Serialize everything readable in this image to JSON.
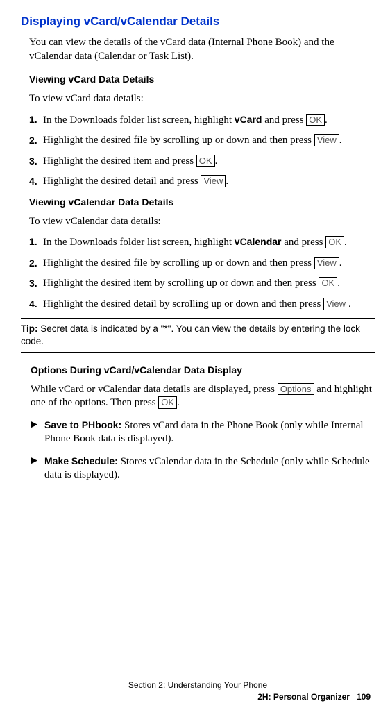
{
  "keys": {
    "ok": "OK",
    "view": "View",
    "options": "Options"
  },
  "bold": {
    "vcard": "vCard",
    "vcalendar": "vCalendar",
    "tip_label": "Tip:",
    "save_phbook": "Save to PHbook:",
    "make_schedule": "Make Schedule:"
  },
  "h1": "Displaying vCard/vCalendar Details",
  "intro": "You can view the details of the vCard data (Internal Phone Book) and the vCalendar data (Calendar or Task List).",
  "vcard": {
    "heading": "Viewing vCard Data Details",
    "intro": "To view vCard data details:",
    "s1_num": "1.",
    "s1_a": "In the Downloads folder list screen, highlight ",
    "s1_b": " and press ",
    "s1_c": ".",
    "s2_num": "2.",
    "s2_a": "Highlight the desired file by scrolling up or down and then press ",
    "s2_b": ".",
    "s3_num": "3.",
    "s3_a": "Highlight the desired item and press ",
    "s3_b": ".",
    "s4_num": "4.",
    "s4_a": "Highlight the desired detail and press ",
    "s4_b": "."
  },
  "vcal": {
    "heading": "Viewing vCalendar Data Details",
    "intro": "To view vCalendar data details:",
    "s1_num": "1.",
    "s1_a": "In the Downloads folder list screen, highlight ",
    "s1_b": " and press ",
    "s1_c": ".",
    "s2_num": "2.",
    "s2_a": "Highlight the desired file by scrolling up or down and then press ",
    "s2_b": ".",
    "s3_num": "3.",
    "s3_a": "Highlight the desired item by scrolling up or down and then press ",
    "s3_b": ".",
    "s4_num": "4.",
    "s4_a": "Highlight the desired detail by scrolling up or down and then press ",
    "s4_b": "."
  },
  "tip_body": " Secret data is indicated by a \"*\". You can view the details by entering the lock code.",
  "options": {
    "heading": "Options During vCard/vCalendar Data Display",
    "intro_a": "While vCard or vCalendar data details are displayed, press ",
    "intro_b": " and highlight one of the options. Then press ",
    "intro_c": ".",
    "b1": " Stores vCard data in the Phone Book (only while Internal Phone Book data is displayed).",
    "b2": " Stores vCalendar data in the Schedule (only while Schedule data is displayed)."
  },
  "footer": {
    "line1": "Section 2: Understanding Your Phone",
    "line2": "2H: Personal Organizer",
    "page": "109"
  }
}
